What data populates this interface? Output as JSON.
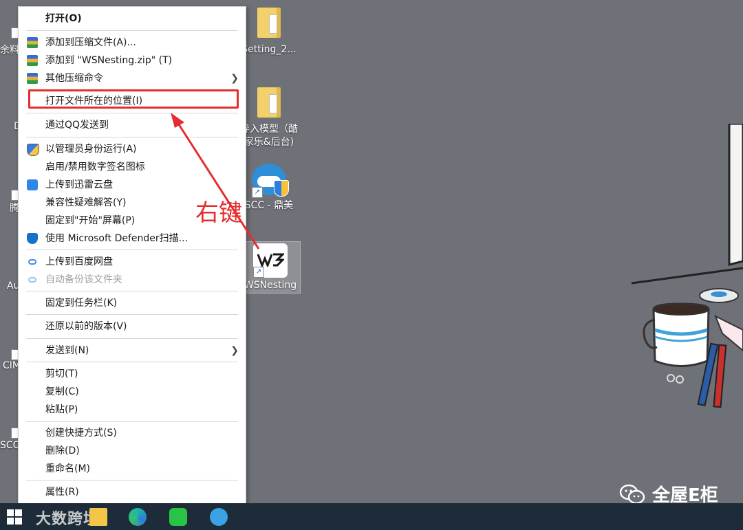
{
  "desktop": {
    "icons": [
      {
        "label": "Setting_2..."
      },
      {
        "label_line1": "导入模型（酷",
        "label_line2": "家乐&后台)"
      },
      {
        "label": "SCC - 鼎美"
      },
      {
        "label": "WSNesting"
      }
    ],
    "left_partials": [
      "余料",
      "D",
      "腾",
      "Au",
      "CIM",
      "SCC"
    ]
  },
  "context_menu": {
    "items": [
      {
        "label": "打开(O)"
      },
      {
        "label": "添加到压缩文件(A)..."
      },
      {
        "label": "添加到 \"WSNesting.zip\" (T)"
      },
      {
        "label": "其他压缩命令"
      },
      {
        "label": "打开文件所在的位置(I)"
      },
      {
        "label": "通过QQ发送到"
      },
      {
        "label": "以管理员身份运行(A)"
      },
      {
        "label": "启用/禁用数字签名图标"
      },
      {
        "label": "上传到迅雷云盘"
      },
      {
        "label": "兼容性疑难解答(Y)"
      },
      {
        "label": "固定到\"开始\"屏幕(P)"
      },
      {
        "label": "使用 Microsoft Defender扫描..."
      },
      {
        "label": "上传到百度网盘"
      },
      {
        "label": "自动备份该文件夹"
      },
      {
        "label": "固定到任务栏(K)"
      },
      {
        "label": "还原以前的版本(V)"
      },
      {
        "label": "发送到(N)"
      },
      {
        "label": "剪切(T)"
      },
      {
        "label": "复制(C)"
      },
      {
        "label": "粘贴(P)"
      },
      {
        "label": "创建快捷方式(S)"
      },
      {
        "label": "删除(D)"
      },
      {
        "label": "重命名(M)"
      },
      {
        "label": "属性(R)"
      }
    ]
  },
  "annotation": {
    "text": "右键",
    "color": "#e52d2d"
  },
  "taskbar": {
    "watermark": "大数跨境"
  },
  "brand": {
    "text": "全屋E柜"
  }
}
